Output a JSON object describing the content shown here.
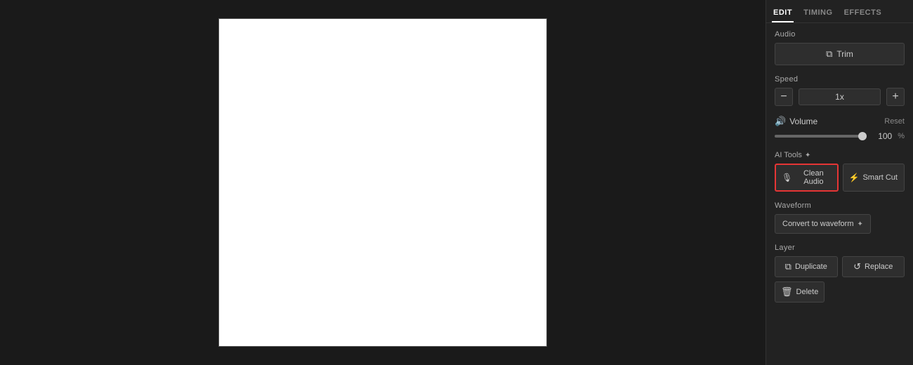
{
  "tabs": [
    {
      "label": "EDIT",
      "active": true
    },
    {
      "label": "TIMING",
      "active": false
    },
    {
      "label": "EFFECTS",
      "active": false
    }
  ],
  "audio": {
    "section_label": "Audio",
    "trim_label": "Trim",
    "trim_icon": "✂"
  },
  "speed": {
    "section_label": "Speed",
    "decrease_label": "−",
    "value": "1x",
    "increase_label": "+"
  },
  "volume": {
    "section_label": "Volume",
    "icon": "🔊",
    "reset_label": "Reset",
    "value": "100",
    "unit": "%"
  },
  "ai_tools": {
    "section_label": "AI Tools",
    "sparkle_icon": "✦",
    "clean_audio": {
      "label": "Clean Audio",
      "icon": "🎙",
      "active": true
    },
    "smart_cut": {
      "label": "Smart Cut",
      "icon": "⚡",
      "active": false
    }
  },
  "waveform": {
    "section_label": "Waveform",
    "btn_label": "Convert to waveform",
    "btn_icon": "✦"
  },
  "layer": {
    "section_label": "Layer",
    "duplicate_label": "Duplicate",
    "duplicate_icon": "⧉",
    "replace_label": "Replace",
    "replace_icon": "↺",
    "delete_label": "Delete",
    "delete_icon": "🗑"
  }
}
